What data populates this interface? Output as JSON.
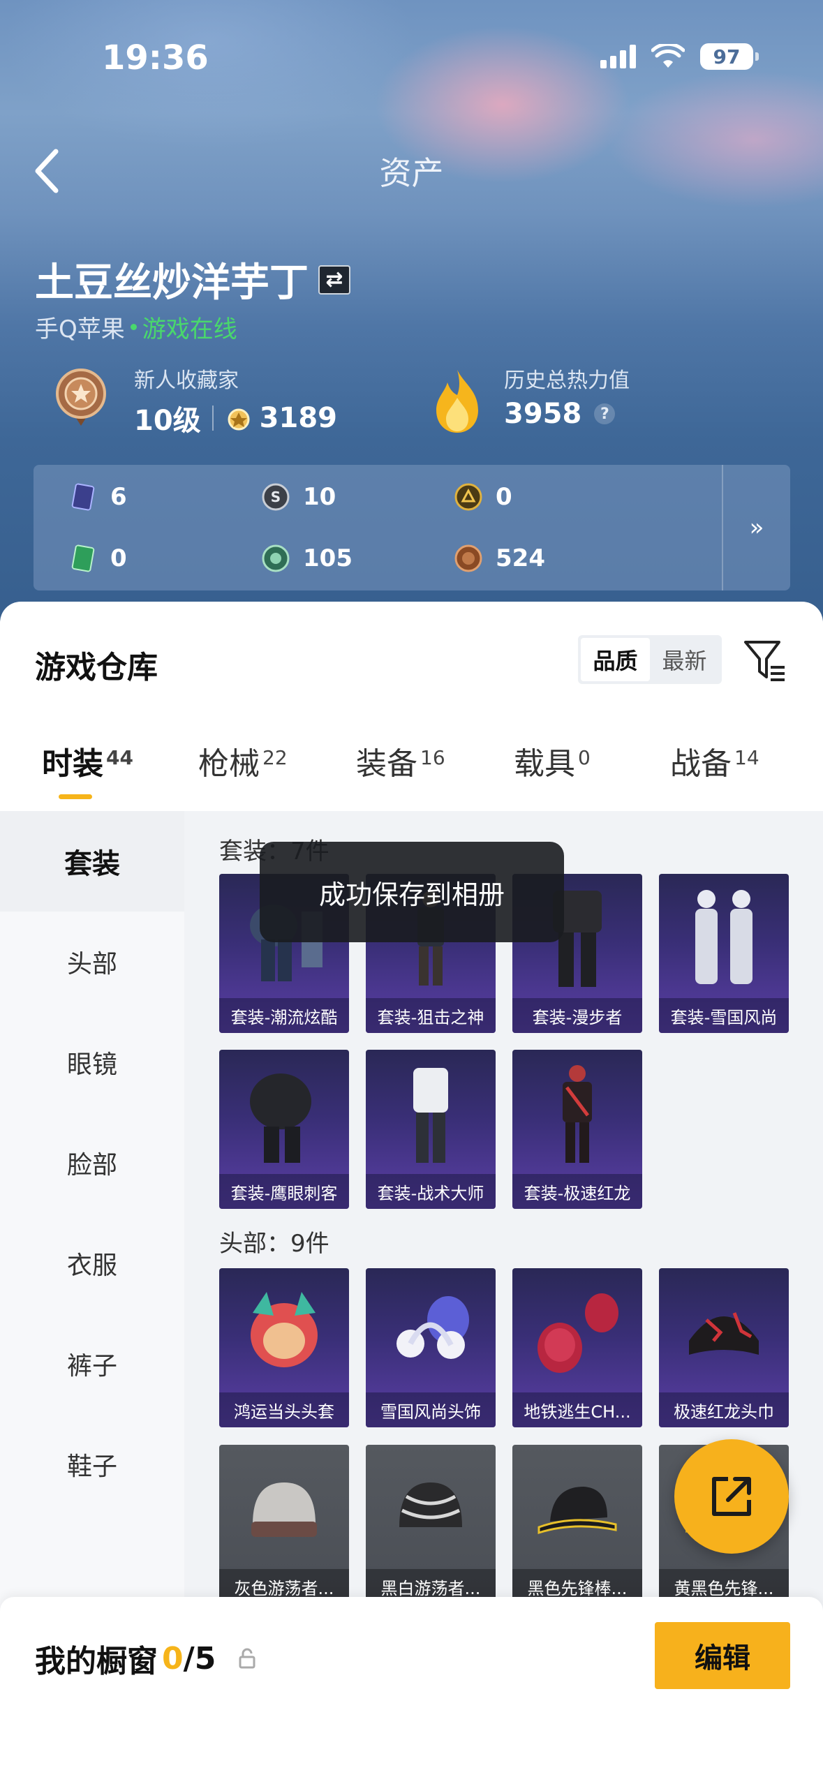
{
  "status": {
    "time": "19:36",
    "battery": "97"
  },
  "nav": {
    "title": "资产"
  },
  "profile": {
    "name": "土豆丝炒洋芋丁",
    "platform": "手Q苹果",
    "online_status": "游戏在线",
    "collector_title": "新人收藏家",
    "level": "10级",
    "collector_points": "3189",
    "heat_title": "历史总热力值",
    "heat_value": "3958",
    "help": "?"
  },
  "currencies": [
    {
      "icon": "card-icon",
      "value": "6",
      "color": "#3b3f8c"
    },
    {
      "icon": "silver-coin-icon",
      "value": "10",
      "color": "#6d7480"
    },
    {
      "icon": "gold-coin-icon",
      "value": "0",
      "color": "#b28a28"
    },
    {
      "icon": "green-ticket-icon",
      "value": "0",
      "color": "#2e9e5a"
    },
    {
      "icon": "jade-coin-icon",
      "value": "105",
      "color": "#3f8f6a"
    },
    {
      "icon": "bronze-coin-icon",
      "value": "524",
      "color": "#9a5a2e"
    }
  ],
  "currency_more": "»",
  "warehouse": {
    "title": "游戏仓库",
    "sort": [
      "品质",
      "最新"
    ],
    "tabs": [
      {
        "label": "时装",
        "count": "44"
      },
      {
        "label": "枪械",
        "count": "22"
      },
      {
        "label": "装备",
        "count": "16"
      },
      {
        "label": "载具",
        "count": "0"
      },
      {
        "label": "战备",
        "count": "14"
      }
    ],
    "sidebar": [
      "套装",
      "头部",
      "眼镜",
      "脸部",
      "衣服",
      "裤子",
      "鞋子"
    ],
    "sections": [
      {
        "title": "套装：7件",
        "items": [
          "套装-潮流炫酷",
          "套装-狙击之神",
          "套装-漫步者",
          "套装-雪国风尚",
          "套装-鹰眼刺客",
          "套装-战术大师",
          "套装-极速红龙"
        ]
      },
      {
        "title": "头部：9件",
        "items": [
          "鸿运当头头套",
          "雪国风尚头饰",
          "地铁逃生CH...",
          "极速红龙头巾",
          "灰色游荡者...",
          "黑白游荡者...",
          "黑色先锋棒...",
          "黄黑色先锋..."
        ]
      }
    ]
  },
  "toast": "成功保存到相册",
  "showcase": {
    "label": "我的橱窗",
    "current": "0",
    "total": "/5"
  },
  "edit_label": "编辑",
  "colors": {
    "accent": "#f7b11c",
    "online": "#49d86c",
    "card_purple": "#3a2f78"
  }
}
